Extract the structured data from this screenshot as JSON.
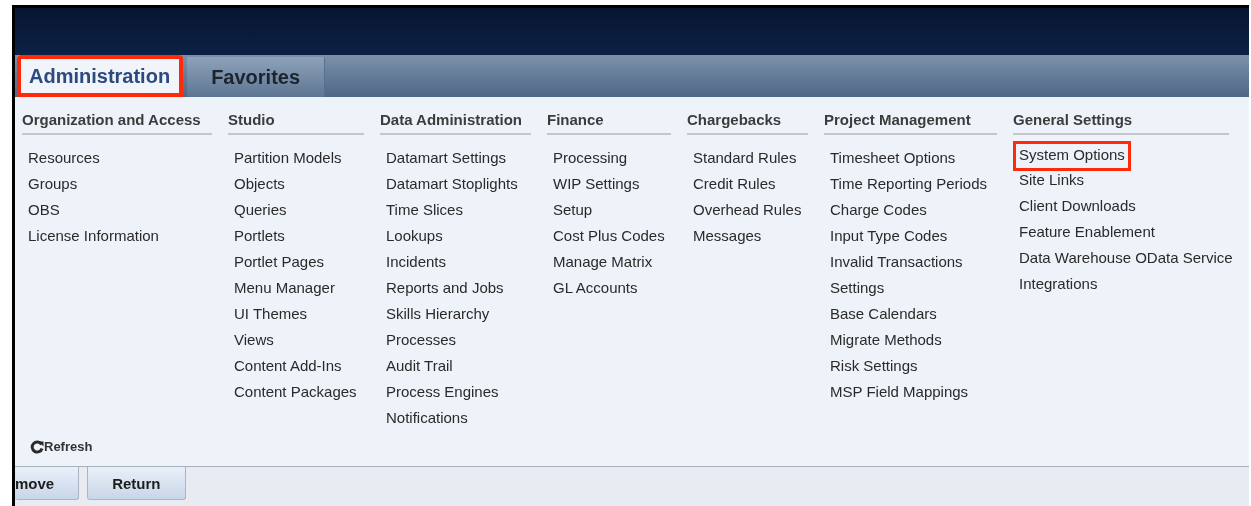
{
  "tabs": [
    {
      "label": "Administration",
      "selected": true,
      "highlighted": true
    },
    {
      "label": "Favorites",
      "selected": false,
      "highlighted": false
    }
  ],
  "menu_columns": [
    {
      "heading": "Organization and Access",
      "items": [
        {
          "label": "Resources",
          "highlighted": false
        },
        {
          "label": "Groups",
          "highlighted": false
        },
        {
          "label": "OBS",
          "highlighted": false
        },
        {
          "label": "License Information",
          "highlighted": false
        }
      ]
    },
    {
      "heading": "Studio",
      "items": [
        {
          "label": "Partition Models",
          "highlighted": false
        },
        {
          "label": "Objects",
          "highlighted": false
        },
        {
          "label": "Queries",
          "highlighted": false
        },
        {
          "label": "Portlets",
          "highlighted": false
        },
        {
          "label": "Portlet Pages",
          "highlighted": false
        },
        {
          "label": "Menu Manager",
          "highlighted": false
        },
        {
          "label": "UI Themes",
          "highlighted": false
        },
        {
          "label": "Views",
          "highlighted": false
        },
        {
          "label": "Content Add-Ins",
          "highlighted": false
        },
        {
          "label": "Content Packages",
          "highlighted": false
        }
      ]
    },
    {
      "heading": "Data Administration",
      "items": [
        {
          "label": "Datamart Settings",
          "highlighted": false
        },
        {
          "label": "Datamart Stoplights",
          "highlighted": false
        },
        {
          "label": "Time Slices",
          "highlighted": false
        },
        {
          "label": "Lookups",
          "highlighted": false
        },
        {
          "label": "Incidents",
          "highlighted": false
        },
        {
          "label": "Reports and Jobs",
          "highlighted": false
        },
        {
          "label": "Skills Hierarchy",
          "highlighted": false
        },
        {
          "label": "Processes",
          "highlighted": false
        },
        {
          "label": "Audit Trail",
          "highlighted": false
        },
        {
          "label": "Process Engines",
          "highlighted": false
        },
        {
          "label": "Notifications",
          "highlighted": false
        }
      ]
    },
    {
      "heading": "Finance",
      "items": [
        {
          "label": "Processing",
          "highlighted": false
        },
        {
          "label": "WIP Settings",
          "highlighted": false
        },
        {
          "label": "Setup",
          "highlighted": false
        },
        {
          "label": "Cost Plus Codes",
          "highlighted": false
        },
        {
          "label": "Manage Matrix",
          "highlighted": false
        },
        {
          "label": "GL Accounts",
          "highlighted": false
        }
      ]
    },
    {
      "heading": "Chargebacks",
      "items": [
        {
          "label": "Standard Rules",
          "highlighted": false
        },
        {
          "label": "Credit Rules",
          "highlighted": false
        },
        {
          "label": "Overhead Rules",
          "highlighted": false
        },
        {
          "label": "Messages",
          "highlighted": false
        }
      ]
    },
    {
      "heading": "Project Management",
      "items": [
        {
          "label": "Timesheet Options",
          "highlighted": false
        },
        {
          "label": "Time Reporting Periods",
          "highlighted": false
        },
        {
          "label": "Charge Codes",
          "highlighted": false
        },
        {
          "label": "Input Type Codes",
          "highlighted": false
        },
        {
          "label": "Invalid Transactions",
          "highlighted": false
        },
        {
          "label": "Settings",
          "highlighted": false
        },
        {
          "label": "Base Calendars",
          "highlighted": false
        },
        {
          "label": "Migrate Methods",
          "highlighted": false
        },
        {
          "label": "Risk Settings",
          "highlighted": false
        },
        {
          "label": "MSP Field Mappings",
          "highlighted": false
        }
      ]
    },
    {
      "heading": "General Settings",
      "items": [
        {
          "label": "System Options",
          "highlighted": true
        },
        {
          "label": "Site Links",
          "highlighted": false
        },
        {
          "label": "Client Downloads",
          "highlighted": false
        },
        {
          "label": "Feature Enablement",
          "highlighted": false
        },
        {
          "label": "Data Warehouse OData Service",
          "highlighted": false
        },
        {
          "label": "Integrations",
          "highlighted": false
        }
      ]
    }
  ],
  "refresh": {
    "label": "Refresh"
  },
  "buttons": [
    "move",
    "Return"
  ]
}
